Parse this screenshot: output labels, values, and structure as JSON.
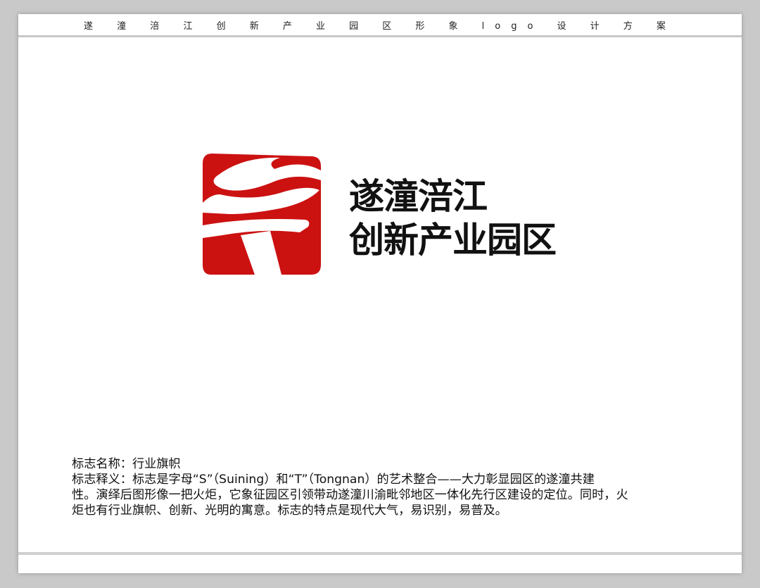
{
  "header": {
    "title": "遂 潼 涪 江 创 新 产 业 园 区 形 象 logo 设 计 方 案"
  },
  "logo": {
    "icon": "s-torch-logo-icon",
    "brand_color": "#cc1111",
    "name_line1": "遂潼涪江",
    "name_line2": "创新产业园区"
  },
  "description": {
    "line1": "标志名称：行业旗帜",
    "line2": "标志释义：标志是字母“S”（Suining）和“T”（Tongnan）的艺术整合——大力彰显园区的遂潼共建",
    "line3": "性。演绎后图形像一把火炬，它象征园区引领带动遂潼川渝毗邻地区一体化先行区建设的定位。同时，火",
    "line4": "炬也有行业旗帜、创新、光明的寓意。标志的特点是现代大气，易识别，易普及。"
  }
}
